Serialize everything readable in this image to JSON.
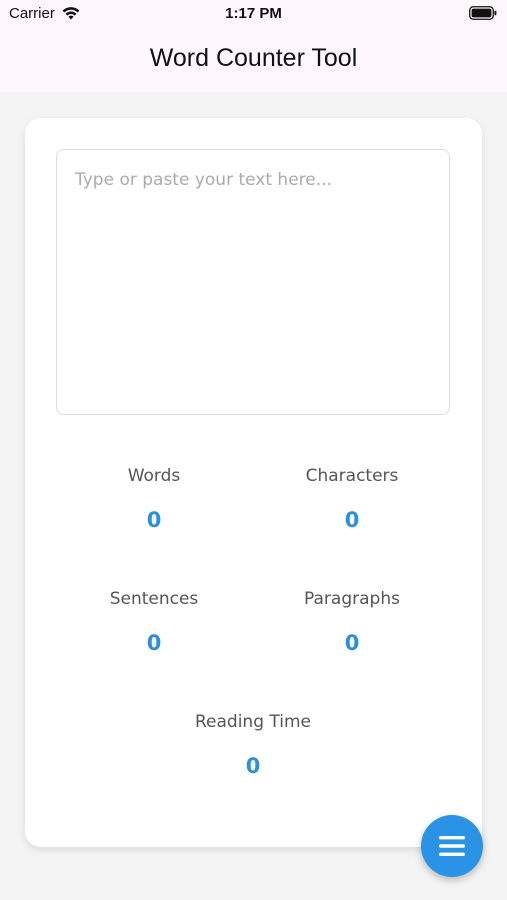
{
  "status_bar": {
    "carrier": "Carrier",
    "time": "1:17 PM"
  },
  "nav": {
    "title": "Word Counter Tool"
  },
  "editor": {
    "placeholder": "Type or paste your text here...",
    "value": ""
  },
  "stats": {
    "words": {
      "label": "Words",
      "value": "0"
    },
    "characters": {
      "label": "Characters",
      "value": "0"
    },
    "sentences": {
      "label": "Sentences",
      "value": "0"
    },
    "paragraphs": {
      "label": "Paragraphs",
      "value": "0"
    },
    "reading_time": {
      "label": "Reading Time",
      "value": "0"
    }
  },
  "icons": {
    "wifi": "wifi-icon",
    "battery": "battery-icon",
    "menu": "menu-icon"
  },
  "colors": {
    "accent": "#2a93e6",
    "stat_value": "#2a8fe0",
    "header_bg": "#fdf7fb"
  }
}
